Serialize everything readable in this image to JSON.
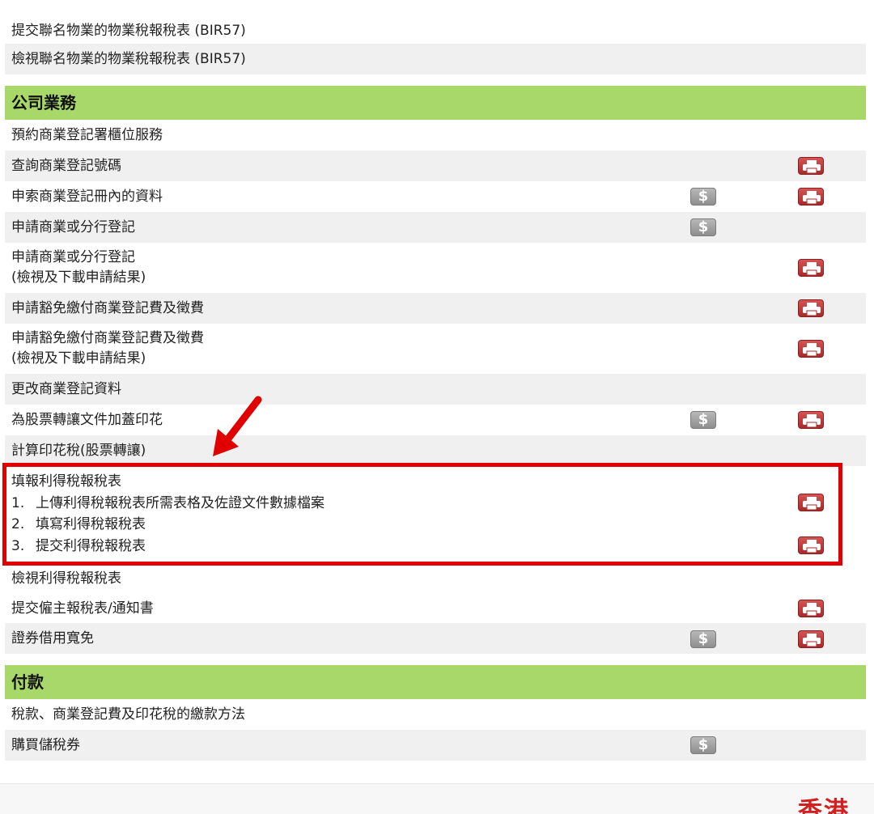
{
  "rows": {
    "r0": {
      "text": "提交聯名物業的物業稅報稅表 (BIR57)"
    },
    "r1": {
      "text": "檢視聯名物業的物業稅報稅表 (BIR57)"
    },
    "company_header": {
      "text": "公司業務"
    },
    "r2": {
      "text": "預約商業登記署櫃位服務"
    },
    "r3": {
      "text": "查詢商業登記號碼"
    },
    "r4": {
      "text": "申索商業登記冊內的資料"
    },
    "r5": {
      "text": "申請商業或分行登記"
    },
    "r6": {
      "line1": "申請商業或分行登記",
      "line2": "(檢視及下載申請結果)"
    },
    "r7": {
      "text": "申請豁免繳付商業登記費及徵費"
    },
    "r8": {
      "line1": "申請豁免繳付商業登記費及徵費",
      "line2": "(檢視及下載申請結果)"
    },
    "r9": {
      "text": "更改商業登記資料"
    },
    "r10": {
      "text": "為股票轉讓文件加蓋印花"
    },
    "r11": {
      "text": "計算印花稅(股票轉讓)"
    },
    "r12": {
      "title": "填報利得稅報稅表",
      "steps": [
        {
          "num": "1.",
          "text": "上傳利得稅報稅表所需表格及佐證文件數據檔案"
        },
        {
          "num": "2.",
          "text": "填寫利得稅報稅表"
        },
        {
          "num": "3.",
          "text": "提交利得稅報稅表"
        }
      ]
    },
    "r13": {
      "text": "檢視利得稅報稅表"
    },
    "r14": {
      "text": "提交僱主報稅表/通知書"
    },
    "r15": {
      "text": "證券借用寬免"
    },
    "payment_header": {
      "text": "付款"
    },
    "r16": {
      "text": "稅款、商業登記費及印花稅的繳款方法"
    },
    "r17": {
      "text": "購買儲稅券"
    }
  },
  "icons": {
    "dollar_symbol": "$",
    "dollar_icon_name": "payment-dollar-icon",
    "printer_icon_name": "printer-icon"
  },
  "footer": {
    "corner_text": "香港"
  },
  "colors": {
    "section_header": "#a8d86a",
    "row_shade": "#f0f0f0",
    "highlight": "#e00000",
    "printer_icon": "#b83232",
    "dollar_icon": "#9e9e9e"
  }
}
